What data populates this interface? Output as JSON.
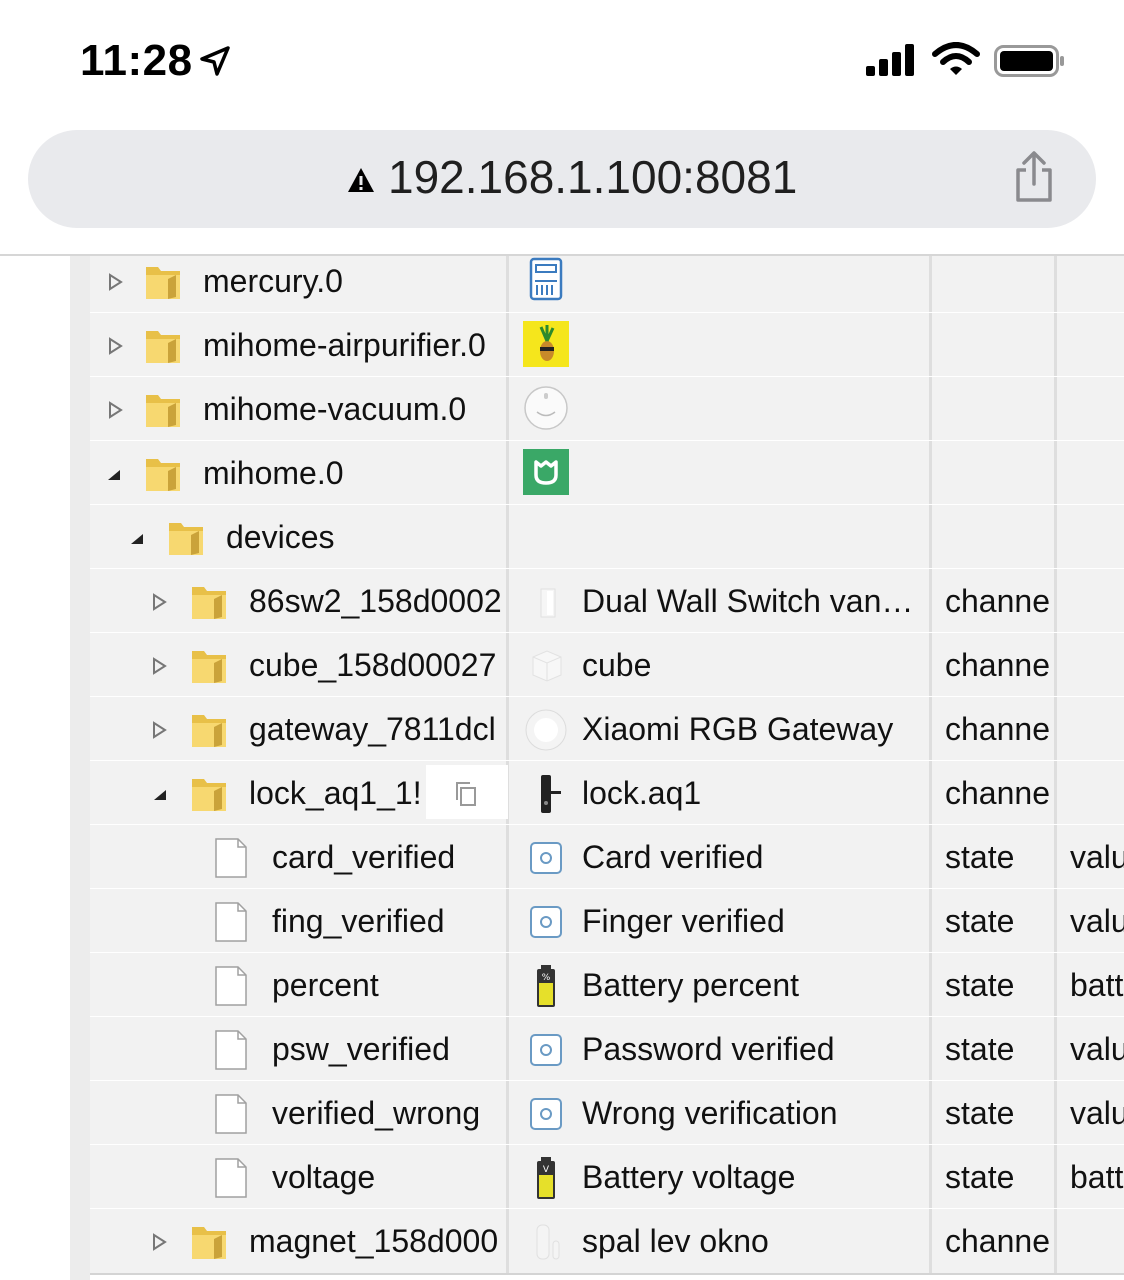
{
  "status_bar": {
    "time": "11:28"
  },
  "browser": {
    "url": "192.168.1.100:8081"
  },
  "rows": [
    {
      "name": "mercury.0",
      "title": "",
      "type": "",
      "role": ""
    },
    {
      "name": "mihome-airpurifier.0",
      "title": "",
      "type": "",
      "role": ""
    },
    {
      "name": "mihome-vacuum.0",
      "title": "",
      "type": "",
      "role": ""
    },
    {
      "name": "mihome.0",
      "title": "",
      "type": "",
      "role": ""
    },
    {
      "name": "devices",
      "title": "",
      "type": "",
      "role": ""
    },
    {
      "name": "86sw2_158d0002",
      "title": "Dual Wall Switch van…",
      "type": "channe",
      "role": ""
    },
    {
      "name": "cube_158d00027",
      "title": "cube",
      "type": "channe",
      "role": ""
    },
    {
      "name": "gateway_7811dcl",
      "title": "Xiaomi RGB Gateway",
      "type": "channe",
      "role": ""
    },
    {
      "name": "lock_aq1_1!",
      "title": "lock.aq1",
      "type": "channe",
      "role": ""
    },
    {
      "name": "card_verified",
      "title": "Card verified",
      "type": "state",
      "role": "valu"
    },
    {
      "name": "fing_verified",
      "title": "Finger verified",
      "type": "state",
      "role": "valu"
    },
    {
      "name": "percent",
      "title": "Battery percent",
      "type": "state",
      "role": "batt"
    },
    {
      "name": "psw_verified",
      "title": "Password verified",
      "type": "state",
      "role": "valu"
    },
    {
      "name": "verified_wrong",
      "title": "Wrong verification",
      "type": "state",
      "role": "valu"
    },
    {
      "name": "voltage",
      "title": "Battery voltage",
      "type": "state",
      "role": "batt"
    },
    {
      "name": "magnet_158d000",
      "title": "spal lev okno",
      "type": "channe",
      "role": ""
    }
  ]
}
